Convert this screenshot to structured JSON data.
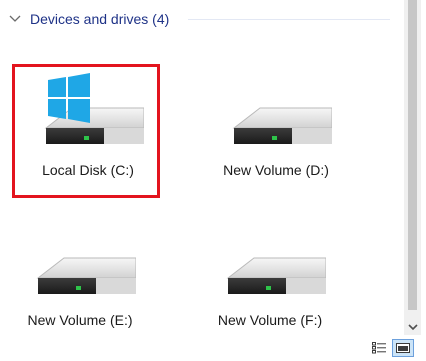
{
  "group": {
    "title": "Devices and drives (4)",
    "collapse_icon": "chevron-down-icon"
  },
  "drives": [
    {
      "label": "Local Disk (C:)",
      "icon": "windows-drive-icon",
      "selected": true
    },
    {
      "label": "New Volume (D:)",
      "icon": "drive-icon",
      "selected": false
    },
    {
      "label": "New Volume (E:)",
      "icon": "drive-icon",
      "selected": false
    },
    {
      "label": "New Volume (F:)",
      "icon": "drive-icon",
      "selected": false
    }
  ],
  "view_buttons": {
    "details_icon": "details-view-icon",
    "tiles_icon": "large-icons-view-icon",
    "active": "tiles"
  },
  "colors": {
    "group_title": "#1e3287",
    "selection_outline": "#e3141e",
    "drive_led": "#2ec44a",
    "windows_logo": "#1fa7e6"
  }
}
